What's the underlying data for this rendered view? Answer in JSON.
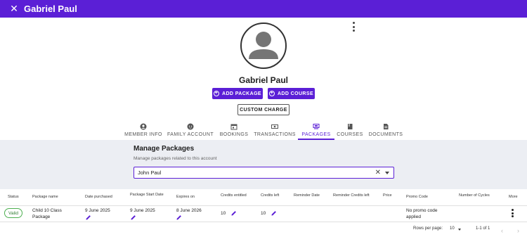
{
  "header": {
    "title": "Gabriel Paul"
  },
  "profile": {
    "name": "Gabriel Paul"
  },
  "actions": {
    "add_package": "ADD PACKAGE",
    "add_course": "ADD COURSE",
    "custom_charge": "CUSTOM CHARGE"
  },
  "tabs": [
    {
      "label": "MEMBER INFO",
      "icon": "account-circle-icon"
    },
    {
      "label": "FAMILY ACCOUNT",
      "icon": "face-icon"
    },
    {
      "label": "BOOKINGS",
      "icon": "calendar-icon"
    },
    {
      "label": "TRANSACTIONS",
      "icon": "money-icon"
    },
    {
      "label": "PACKAGES",
      "icon": "package-icon",
      "active": true
    },
    {
      "label": "COURSES",
      "icon": "book-icon"
    },
    {
      "label": "DOCUMENTS",
      "icon": "document-icon"
    }
  ],
  "manage": {
    "title": "Manage Packages",
    "subtitle": "Manage packages related to this account",
    "selected_member": "John Paul"
  },
  "table": {
    "columns": [
      "Status",
      "Package name",
      "Date purchased",
      "Package Start Date",
      "Expires on",
      "Credits entitled",
      "Credits left",
      "Reminder Date",
      "Reminder Credits left",
      "Price",
      "Promo Code",
      "Number of Cycles",
      "More"
    ],
    "rows": [
      {
        "status": "Valid",
        "package_name_1": "Child 10 Class",
        "package_name_2": "Package",
        "date_purchased": "9 June 2025",
        "start_date": "9 June 2025",
        "expires_on": "8 June 2026",
        "credits_entitled": "10",
        "credits_left": "10",
        "promo_1": "No promo code",
        "promo_2": "applied"
      }
    ]
  },
  "pagination": {
    "rows_per_page_label": "Rows per page:",
    "rows_per_page": "10",
    "range": "1-1 of 1"
  },
  "colors": {
    "primary": "#5b1fd6",
    "valid": "#4caf50",
    "panel_bg": "#eceef3"
  }
}
